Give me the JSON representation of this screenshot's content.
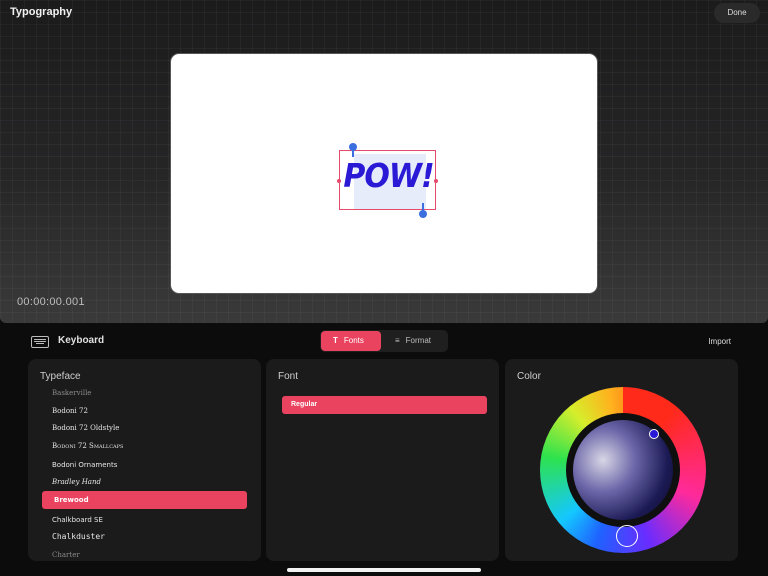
{
  "header": {
    "title": "Typography",
    "done_label": "Done"
  },
  "canvas": {
    "text": "POW!",
    "timecode": "00:00:00.001"
  },
  "toolbar": {
    "keyboard_label": "Keyboard",
    "tabs": [
      {
        "label": "Fonts",
        "icon": "text-T-icon",
        "active": true
      },
      {
        "label": "Format",
        "icon": "align-icon",
        "active": false
      }
    ],
    "import_label": "Import"
  },
  "typeface": {
    "title": "Typeface",
    "items": [
      "Baskerville",
      "Bodoni 72",
      "Bodoni 72 Oldstyle",
      "Bodoni 72 Smallcaps",
      "Bodoni Ornaments",
      "Bradley Hand",
      "Brewood",
      "Chalkboard SE",
      "Chalkduster",
      "Charter"
    ],
    "selected": "Brewood"
  },
  "font": {
    "title": "Font",
    "selected": "Regular"
  },
  "color": {
    "title": "Color",
    "accent": "#e9435f",
    "text_color": "#2a1ad6"
  }
}
